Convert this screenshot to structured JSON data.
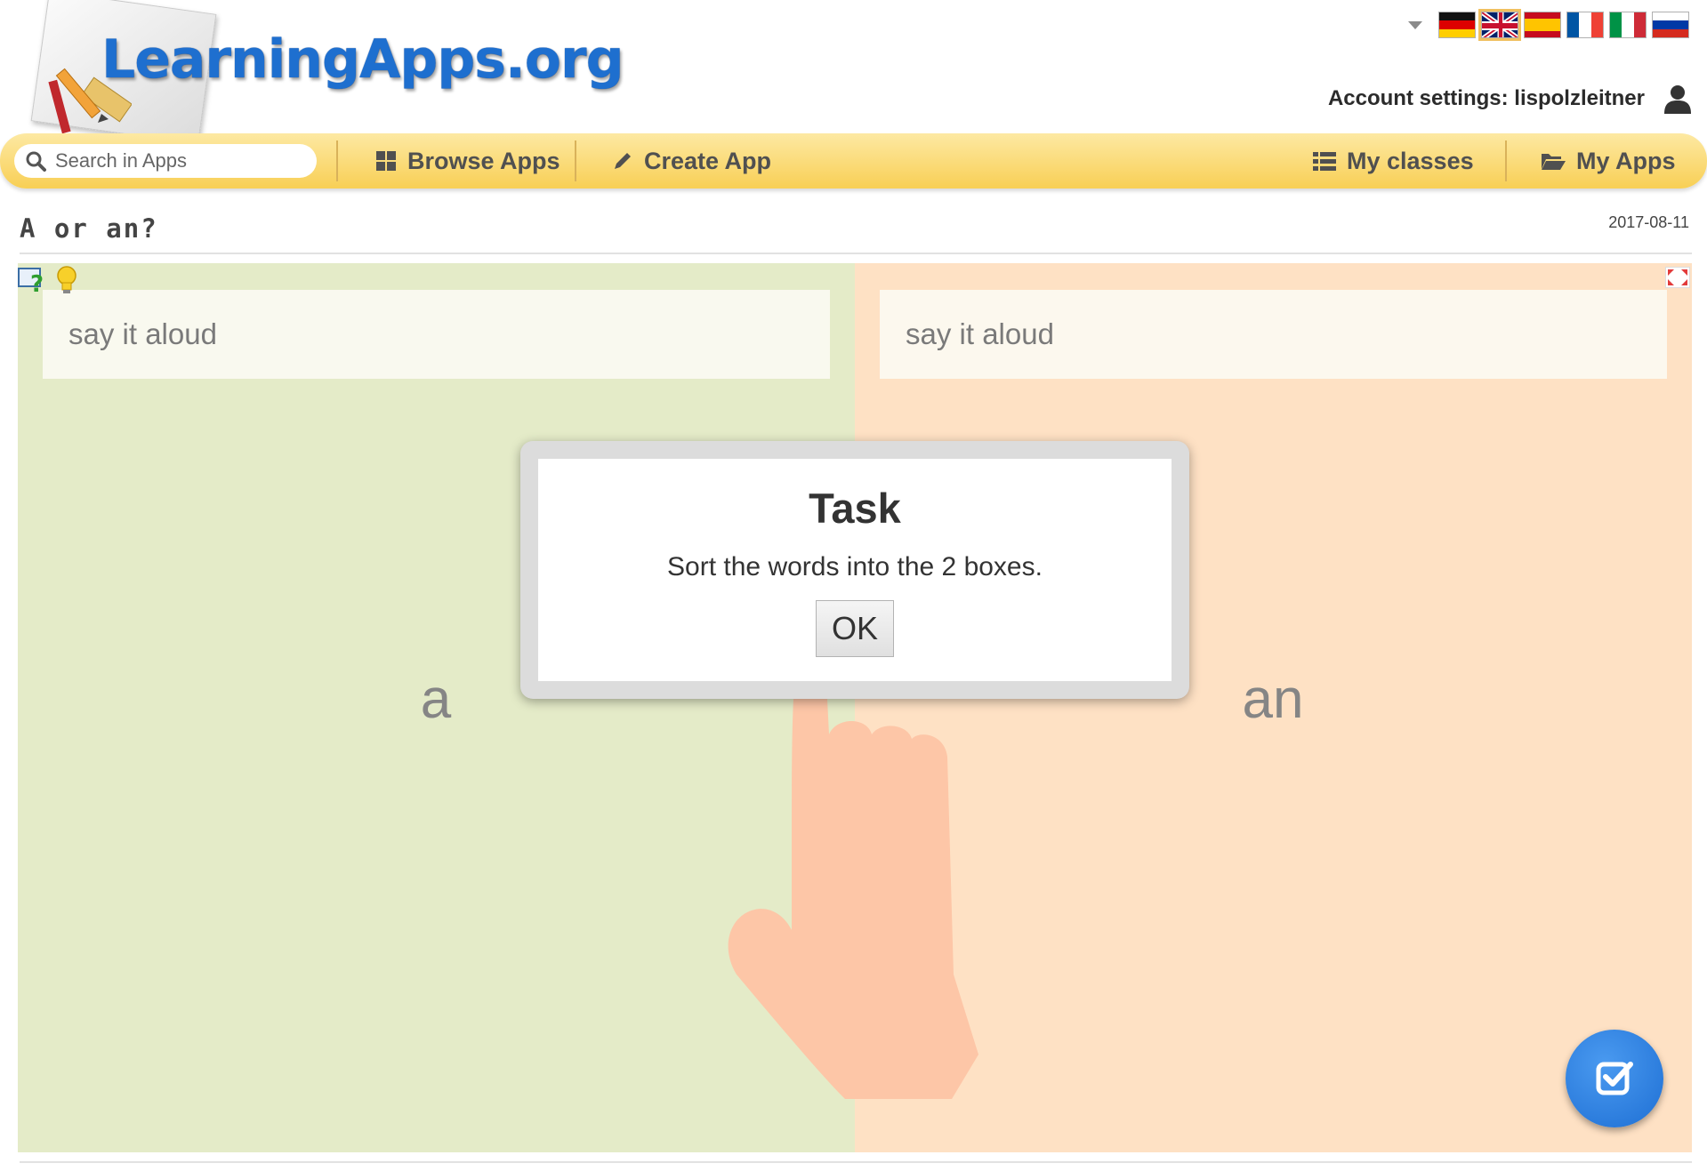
{
  "header": {
    "logo_text": "LearningApps.org",
    "languages": [
      {
        "name": "German",
        "active": false
      },
      {
        "name": "English",
        "active": true
      },
      {
        "name": "Spanish",
        "active": false
      },
      {
        "name": "French",
        "active": false
      },
      {
        "name": "Italian",
        "active": false
      },
      {
        "name": "Russian",
        "active": false
      }
    ],
    "account_label": "Account settings: lispolzleitner"
  },
  "nav": {
    "search_placeholder": "Search in Apps",
    "browse_label": "Browse Apps",
    "create_label": "Create App",
    "classes_label": "My classes",
    "myapps_label": "My Apps"
  },
  "app": {
    "title": "A or an?",
    "date": "2017-08-11",
    "left_zone": {
      "prompt": "say it aloud",
      "label": "a",
      "color": "#e4ebc8"
    },
    "right_zone": {
      "prompt": "say it aloud",
      "label": "an",
      "color": "#fee1c4"
    }
  },
  "dialog": {
    "title": "Task",
    "text": "Sort the words into the 2 boxes.",
    "ok_label": "OK"
  },
  "colors": {
    "nav_bar": "#f8cf55",
    "check_button": "#1e6fd4",
    "logo_blue": "#1e6fcf"
  }
}
